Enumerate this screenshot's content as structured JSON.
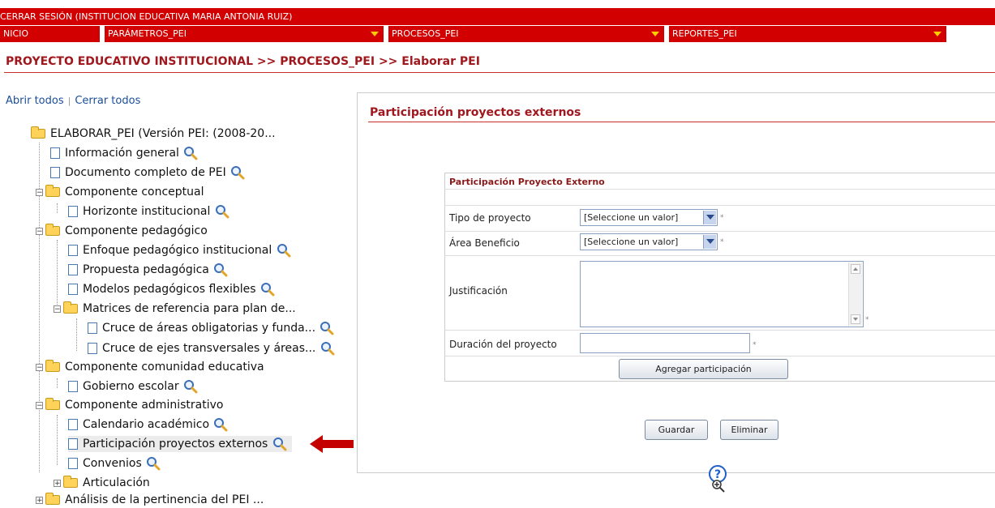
{
  "header": {
    "session_text": "CERRAR SESIÓN (INSTITUCION EDUCATIVA MARIA ANTONIA RUIZ)"
  },
  "menu": {
    "items": [
      {
        "label": "NICIO"
      },
      {
        "label": "PARÁMETROS_PEI"
      },
      {
        "label": "PROCESOS_PEI"
      },
      {
        "label": "REPORTES_PEI"
      }
    ]
  },
  "breadcrumb": "PROYECTO EDUCATIVO INSTITUCIONAL >> PROCESOS_PEI >> Elaborar PEI",
  "tree_links": {
    "open_all": "Abrir todos",
    "separator": "|",
    "close_all": "Cerrar todos"
  },
  "tree": {
    "root": "ELABORAR_PEI (Versión PEI: (2008-20...",
    "n1": "Información general",
    "n2": "Documento completo de PEI",
    "n3": "Componente conceptual",
    "n4": "Horizonte institucional",
    "n5": "Componente pedagógico",
    "n6": "Enfoque pedagógico institucional",
    "n7": "Propuesta pedagógica",
    "n8": "Modelos pedagógicos flexibles",
    "n9": "Matrices de referencia para plan de...",
    "n10": "Cruce de áreas obligatorias y funda...",
    "n11": "Cruce de ejes transversales y áreas...",
    "n12": "Componente comunidad educativa",
    "n13": "Gobierno escolar",
    "n14": "Componente administrativo",
    "n15": "Calendario académico",
    "n16": "Participación proyectos externos",
    "n17": "Convenios",
    "n18": "Articulación",
    "n19": "Análisis de la pertinencia del PEI ..."
  },
  "panel": {
    "title": "Participación proyectos externos",
    "form_title": "Participación Proyecto Externo",
    "fields": {
      "tipo_label": "Tipo de proyecto",
      "tipo_value": "[Seleccione un valor]",
      "area_label": "Área Beneficio",
      "area_value": "[Seleccione un valor]",
      "justificacion_label": "Justificación",
      "justificacion_value": "",
      "duracion_label": "Duración del proyecto",
      "duracion_value": "",
      "required_mark": "*"
    },
    "add_button": "Agregar participación",
    "save_button": "Guardar",
    "delete_button": "Eliminar"
  },
  "colors": {
    "brand_red": "#d20000",
    "title_red": "#a0181d",
    "menu_arrow": "#ffcc00",
    "selection_arrow": "#c40000"
  }
}
